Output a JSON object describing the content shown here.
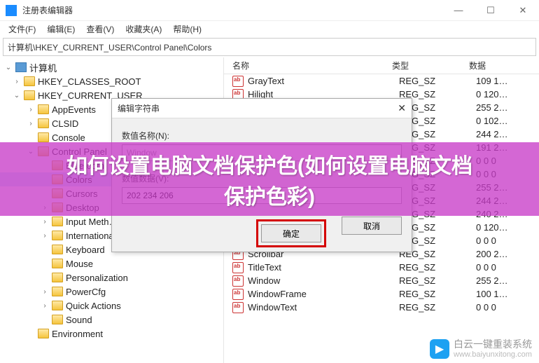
{
  "window": {
    "title": "注册表编辑器",
    "buttons": {
      "min": "—",
      "max": "☐",
      "close": "✕"
    }
  },
  "menu": [
    "文件(F)",
    "编辑(E)",
    "查看(V)",
    "收藏夹(A)",
    "帮助(H)"
  ],
  "address": "计算机\\HKEY_CURRENT_USER\\Control Panel\\Colors",
  "tree": {
    "root": "计算机",
    "nodes": [
      {
        "label": "HKEY_CLASSES_ROOT",
        "depth": 1,
        "exp": "›"
      },
      {
        "label": "HKEY_CURRENT_USER",
        "depth": 1,
        "exp": "⌄"
      },
      {
        "label": "AppEvents",
        "depth": 2,
        "exp": "›"
      },
      {
        "label": "CLSID",
        "depth": 2,
        "exp": "›"
      },
      {
        "label": "Console",
        "depth": 2,
        "exp": ""
      },
      {
        "label": "Control Panel",
        "depth": 2,
        "exp": "⌄"
      },
      {
        "label": "Bluetooth",
        "depth": 3,
        "exp": ""
      },
      {
        "label": "Colors",
        "depth": 3,
        "exp": "",
        "selected": true
      },
      {
        "label": "Cursors",
        "depth": 3,
        "exp": ""
      },
      {
        "label": "Desktop",
        "depth": 3,
        "exp": "›"
      },
      {
        "label": "Input Meth…",
        "depth": 3,
        "exp": "›"
      },
      {
        "label": "International",
        "depth": 3,
        "exp": "›"
      },
      {
        "label": "Keyboard",
        "depth": 3,
        "exp": ""
      },
      {
        "label": "Mouse",
        "depth": 3,
        "exp": ""
      },
      {
        "label": "Personalization",
        "depth": 3,
        "exp": ""
      },
      {
        "label": "PowerCfg",
        "depth": 3,
        "exp": "›"
      },
      {
        "label": "Quick Actions",
        "depth": 3,
        "exp": "›"
      },
      {
        "label": "Sound",
        "depth": 3,
        "exp": ""
      },
      {
        "label": "Environment",
        "depth": 2,
        "exp": ""
      }
    ]
  },
  "list": {
    "headers": {
      "name": "名称",
      "type": "类型",
      "data": "数据"
    },
    "rows": [
      {
        "name": "GrayText",
        "type": "REG_SZ",
        "data": "109 1…"
      },
      {
        "name": "Hilight",
        "type": "REG_SZ",
        "data": "0 120…"
      },
      {
        "name": "",
        "type": "REG_SZ",
        "data": "255 2…"
      },
      {
        "name": "",
        "type": "REG_SZ",
        "data": "0 102…"
      },
      {
        "name": "",
        "type": "REG_SZ",
        "data": "244 2…"
      },
      {
        "name": "",
        "type": "REG_SZ",
        "data": "191 2…"
      },
      {
        "name": "",
        "type": "REG_SZ",
        "data": "0 0 0"
      },
      {
        "name": "",
        "type": "REG_SZ",
        "data": "0 0 0"
      },
      {
        "name": "",
        "type": "REG_SZ",
        "data": "255 2…"
      },
      {
        "name": "",
        "type": "REG_SZ",
        "data": "244 2…"
      },
      {
        "name": "",
        "type": "REG_SZ",
        "data": "240 2…"
      },
      {
        "name": "",
        "type": "REG_SZ",
        "data": "0 120…"
      },
      {
        "name": "MenuText",
        "type": "REG_SZ",
        "data": "0 0 0"
      },
      {
        "name": "Scrollbar",
        "type": "REG_SZ",
        "data": "200 2…"
      },
      {
        "name": "TitleText",
        "type": "REG_SZ",
        "data": "0 0 0"
      },
      {
        "name": "Window",
        "type": "REG_SZ",
        "data": "255 2…"
      },
      {
        "name": "WindowFrame",
        "type": "REG_SZ",
        "data": "100 1…"
      },
      {
        "name": "WindowText",
        "type": "REG_SZ",
        "data": "0 0 0"
      }
    ]
  },
  "dialog": {
    "title": "编辑字符串",
    "close": "✕",
    "name_label": "数值名称(N):",
    "name_value": "Window",
    "data_label": "数值数据(V):",
    "data_value": "202 234 206",
    "ok": "确定",
    "cancel": "取消"
  },
  "banner": {
    "line1": "如何设置电脑文档保护色(如何设置电脑文档",
    "line2": "保护色彩)"
  },
  "watermark": {
    "brand": "白云一键重装系统",
    "url": "www.baiyunxitong.com"
  }
}
